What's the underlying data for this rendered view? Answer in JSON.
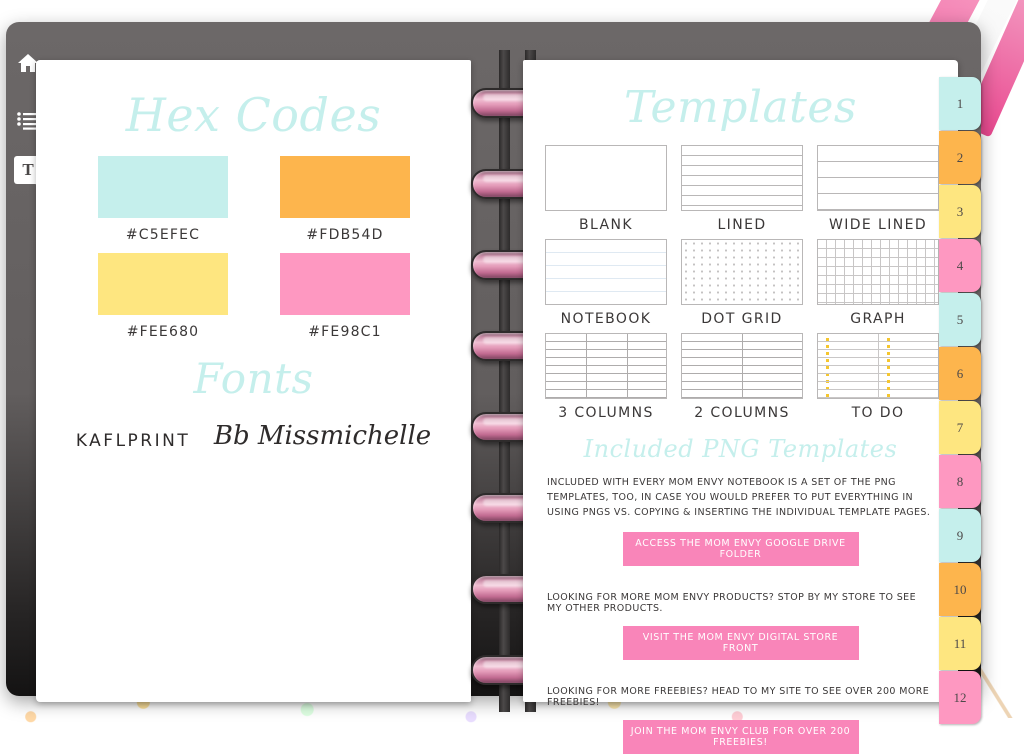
{
  "toolbar": {
    "items": [
      {
        "icon": "home-icon",
        "name": "home"
      },
      {
        "icon": "list-icon",
        "name": "index"
      },
      {
        "icon": "text-tool-icon",
        "name": "text",
        "label": "T"
      }
    ]
  },
  "left_page": {
    "hex_title": "Hex Codes",
    "swatches": [
      {
        "color": "#C5EFEC",
        "label": "#C5EFEC"
      },
      {
        "color": "#FDB54D",
        "label": "#FDB54D"
      },
      {
        "color": "#FEE680",
        "label": "#FEE680"
      },
      {
        "color": "#FE98C1",
        "label": "#FE98C1"
      }
    ],
    "fonts_title": "Fonts",
    "fonts": [
      {
        "sample": "KAFLPRINT"
      },
      {
        "sample": "Bb Missmichelle"
      }
    ]
  },
  "right_page": {
    "templates_title": "Templates",
    "templates": [
      {
        "label": "BLANK",
        "style": "t-blank"
      },
      {
        "label": "LINED",
        "style": "t-lined"
      },
      {
        "label": "WIDE LINED",
        "style": "t-wide"
      },
      {
        "label": "NOTEBOOK",
        "style": "t-notebook"
      },
      {
        "label": "DOT GRID",
        "style": "t-dot"
      },
      {
        "label": "GRAPH",
        "style": "t-graph"
      },
      {
        "label": "3 COLUMNS",
        "style": "t-3col"
      },
      {
        "label": "2 COLUMNS",
        "style": "t-2col"
      },
      {
        "label": "TO DO",
        "style": "t-todo"
      }
    ],
    "png_title": "Included PNG Templates",
    "png_body": "INCLUDED WITH EVERY MOM ENVY NOTEBOOK IS A SET OF THE PNG TEMPLATES, TOO, IN CASE YOU WOULD PREFER TO PUT EVERYTHING IN USING PNGS VS. COPYING & INSERTING THE INDIVIDUAL TEMPLATE PAGES.",
    "cta_drive": "ACCESS THE MOM ENVY GOOGLE DRIVE FOLDER",
    "promo_store": "LOOKING FOR MORE MOM ENVY PRODUCTS? STOP BY MY STORE TO SEE MY OTHER PRODUCTS.",
    "cta_store": "VISIT THE MOM ENVY DIGITAL STORE FRONT",
    "promo_freebies": "LOOKING FOR MORE FREEBIES? HEAD TO MY SITE TO SEE OVER 200 MORE FREEBIES!",
    "cta_club": "JOIN THE MOM ENVY CLUB FOR OVER 200 FREEBIES!"
  },
  "tabs": [
    {
      "label": "1",
      "color": "#c5efec"
    },
    {
      "label": "2",
      "color": "#fdb54d"
    },
    {
      "label": "3",
      "color": "#fee680"
    },
    {
      "label": "4",
      "color": "#fe98c1"
    },
    {
      "label": "5",
      "color": "#c5efec"
    },
    {
      "label": "6",
      "color": "#fdb54d"
    },
    {
      "label": "7",
      "color": "#fee680"
    },
    {
      "label": "8",
      "color": "#fe98c1"
    },
    {
      "label": "9",
      "color": "#c5efec"
    },
    {
      "label": "10",
      "color": "#fdb54d"
    },
    {
      "label": "11",
      "color": "#fee680"
    },
    {
      "label": "12",
      "color": "#fe98c1"
    }
  ],
  "colors": {
    "accent_teal": "#c5efec",
    "accent_pink": "#f985b9",
    "cover": "#625e5e",
    "text": "#3b3838"
  },
  "rings_count": 8
}
